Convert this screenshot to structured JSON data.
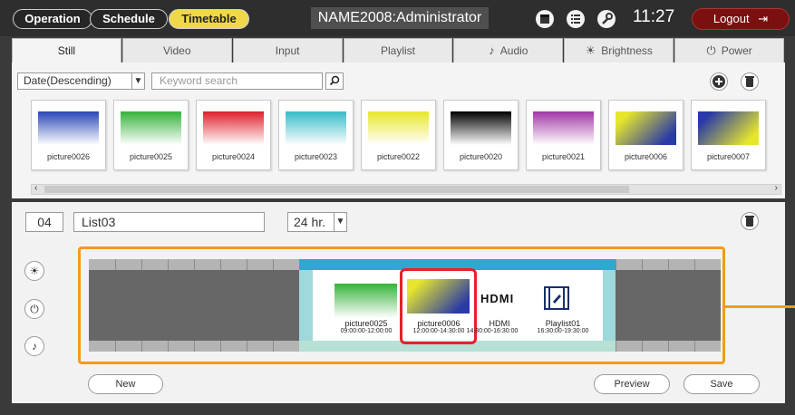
{
  "header": {
    "modes": [
      "Operation",
      "Schedule",
      "Timetable"
    ],
    "active_mode": "Timetable",
    "title": "NAME2008:Administrator",
    "icons": [
      "calendar-icon",
      "list-icon",
      "wrench-icon"
    ],
    "clock": "11:27",
    "logout_label": "Logout"
  },
  "tabs": [
    {
      "label": "Still",
      "icon": ""
    },
    {
      "label": "Video",
      "icon": ""
    },
    {
      "label": "Input",
      "icon": ""
    },
    {
      "label": "Playlist",
      "icon": ""
    },
    {
      "label": "Audio",
      "icon": "music-note-icon"
    },
    {
      "label": "Brightness",
      "icon": "sun-icon"
    },
    {
      "label": "Power",
      "icon": "power-icon"
    }
  ],
  "active_tab": "Still",
  "library": {
    "sort_value": "Date(Descending)",
    "search_placeholder": "Keyword search",
    "thumbnails": [
      {
        "name": "picture0026",
        "colors": [
          "#2a46b8",
          "#ffffff"
        ]
      },
      {
        "name": "picture0025",
        "colors": [
          "#36b33a",
          "#ffffff"
        ]
      },
      {
        "name": "picture0024",
        "colors": [
          "#e0202c",
          "#ffffff"
        ]
      },
      {
        "name": "picture0023",
        "colors": [
          "#35bcc8",
          "#ffffff"
        ]
      },
      {
        "name": "picture0022",
        "colors": [
          "#e8e62a",
          "#ffffff"
        ]
      },
      {
        "name": "picture0020",
        "colors": [
          "#000000",
          "#ffffff"
        ]
      },
      {
        "name": "picture0021",
        "colors": [
          "#a236a6",
          "#ffffff"
        ]
      },
      {
        "name": "picture0006",
        "colors": [
          "#e6e62c",
          "#2a3aa8"
        ]
      },
      {
        "name": "picture0007",
        "colors": [
          "#2a3aa8",
          "#e6e62c"
        ]
      }
    ]
  },
  "schedule": {
    "number": "04",
    "list_name": "List03",
    "hour_mode": "24 hr.",
    "side_buttons": [
      "sun-icon",
      "power-icon",
      "music-note-icon"
    ],
    "items": [
      {
        "name": "picture0025",
        "time": "09:00:00-12:00:00",
        "kind": "image"
      },
      {
        "name": "picture0006",
        "time": "12:00:00-14:30:00",
        "kind": "image",
        "selected": true
      },
      {
        "name": "HDMI",
        "time": "14:30:00-16:30:00",
        "kind": "input"
      },
      {
        "name": "Playlist01",
        "time": "16:30:00-19:30:00",
        "kind": "playlist"
      }
    ],
    "buttons": {
      "new": "New",
      "preview": "Preview",
      "save": "Save"
    }
  }
}
